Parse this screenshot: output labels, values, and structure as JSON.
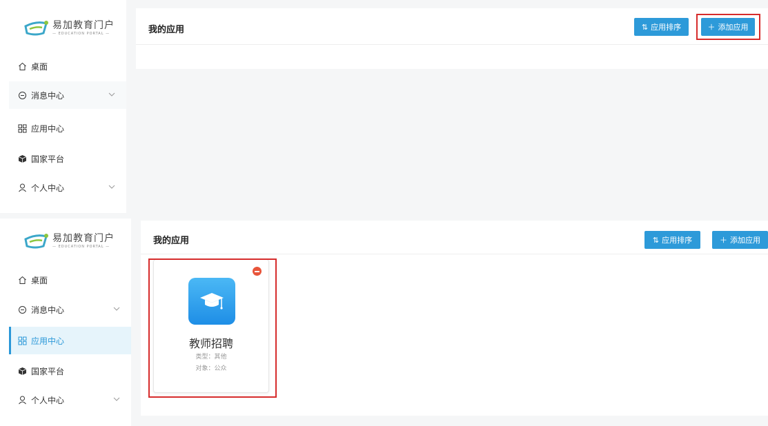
{
  "logo": {
    "title": "易加教育门户",
    "subtitle": "— EDUCATION PORTAL —"
  },
  "sidebar": {
    "items": [
      {
        "label": "桌面",
        "icon": "home-icon"
      },
      {
        "label": "消息中心",
        "icon": "message-icon",
        "has_children": true
      },
      {
        "label": "应用中心",
        "icon": "grid-icon"
      },
      {
        "label": "国家平台",
        "icon": "cube-icon"
      },
      {
        "label": "个人中心",
        "icon": "user-icon",
        "has_children": true
      }
    ]
  },
  "panel1": {
    "page_title": "我的应用",
    "sort_label": "应用排序",
    "add_label": "添加应用",
    "highlight": "add-button"
  },
  "panel2": {
    "page_title": "我的应用",
    "sort_label": "应用排序",
    "add_label": "添加应用",
    "active_nav": "应用中心",
    "app": {
      "name": "教师招聘",
      "type_line": "类型：其他",
      "audience_line": "对象：公众",
      "icon": "graduation-cap-icon"
    }
  },
  "colors": {
    "accent": "#2d9ad9",
    "highlight": "#d62b2b",
    "active_bg": "#e6f4fb",
    "badge": "#e8553b"
  }
}
